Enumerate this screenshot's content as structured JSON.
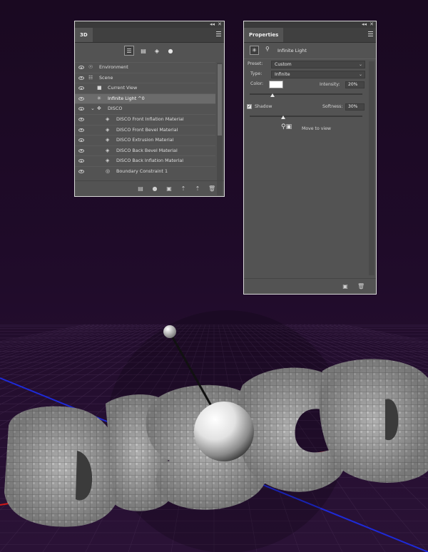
{
  "panel3d": {
    "tab": "3D",
    "collapse_glyph": "◂◂",
    "close_glyph": "✕",
    "filter_icons": [
      "whole-scene-icon",
      "meshes-icon",
      "materials-icon",
      "lights-icon"
    ],
    "rows": [
      {
        "label": "Environment",
        "icon": "environment-icon",
        "visible": true
      },
      {
        "label": "Scene",
        "icon": "scene-icon",
        "visible": true
      },
      {
        "label": "Current View",
        "icon": "camera-icon",
        "visible": true
      },
      {
        "label": "Infinite Light ^0",
        "icon": "infinite-light-icon",
        "visible": true,
        "selected": true
      },
      {
        "label": "DISCO",
        "icon": "mesh-icon",
        "visible": true,
        "expanded": true
      },
      {
        "label": "DISCO Front Inflation Material",
        "icon": "material-icon",
        "visible": true
      },
      {
        "label": "DISCO Front Bevel Material",
        "icon": "material-icon",
        "visible": true
      },
      {
        "label": "DISCO Extrusion Material",
        "icon": "material-icon",
        "visible": true
      },
      {
        "label": "DISCO Back Bevel Material",
        "icon": "material-icon",
        "visible": true
      },
      {
        "label": "DISCO Back Inflation Material",
        "icon": "material-icon",
        "visible": true
      },
      {
        "label": "Boundary Constraint 1",
        "icon": "constraint-icon",
        "visible": true
      }
    ],
    "bottom_icons": [
      "mesh-filter-icon",
      "add-light-icon",
      "render-icon",
      "export-icon",
      "duplicate-icon",
      "trash-icon"
    ]
  },
  "properties": {
    "tab": "Properties",
    "collapse_glyph": "◂◂",
    "close_glyph": "✕",
    "header_title": "Infinite Light",
    "preset_label": "Preset:",
    "preset_value": "Custom",
    "type_label": "Type:",
    "type_value": "Infinite",
    "color_label": "Color:",
    "light_color": "#ffffff",
    "intensity_label": "Intensity:",
    "intensity_value": "20%",
    "intensity_fraction": 0.2,
    "shadow_label": "Shadow",
    "shadow_checked": true,
    "softness_label": "Softness:",
    "softness_value": "30%",
    "softness_fraction": 0.3,
    "move_to_view_label": "Move to view",
    "bottom_icons": [
      "render-icon",
      "trash-icon"
    ]
  },
  "scene": {
    "text": "DISCO",
    "background_color": "#1c0a24",
    "grid_color": "#3a2246",
    "x_axis_color": "#d01818",
    "z_axis_color": "#1e2ad8"
  }
}
